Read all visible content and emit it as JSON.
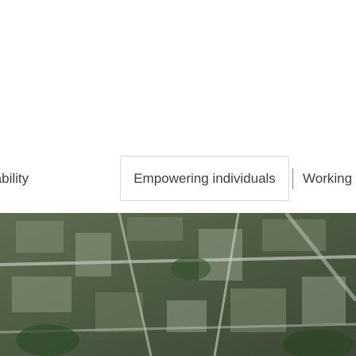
{
  "tabs": [
    {
      "label": "ainability"
    },
    {
      "label": "Empowering individuals"
    },
    {
      "label": "Working toget"
    }
  ],
  "hero": {
    "alt": "Aerial view of a city"
  },
  "colors": {
    "tab_text": "#3c4043",
    "tab_border": "#dadce0",
    "divider": "#80868b"
  },
  "icons": []
}
